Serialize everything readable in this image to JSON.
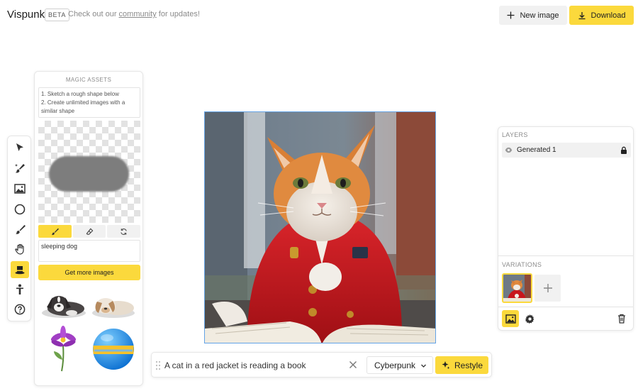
{
  "header": {
    "brand": "Vispunk",
    "beta": "BETA",
    "tagline_before": "Check out our ",
    "tagline_link": "community",
    "tagline_after": " for updates!",
    "new_image_label": "New image",
    "download_label": "Download"
  },
  "tools": [
    {
      "name": "select-tool",
      "icon": "pointer-icon"
    },
    {
      "name": "brush-sparkle-tool",
      "icon": "brush-sparkle-icon"
    },
    {
      "name": "image-tool",
      "icon": "image-icon"
    },
    {
      "name": "shape-tool",
      "icon": "circle-icon"
    },
    {
      "name": "brush-tool",
      "icon": "paintbrush-icon"
    },
    {
      "name": "hand-tool",
      "icon": "hand-icon"
    },
    {
      "name": "magic-assets-tool",
      "icon": "magic-hat-icon",
      "active": true
    },
    {
      "name": "pose-tool",
      "icon": "person-icon"
    },
    {
      "name": "help-tool",
      "icon": "help-icon"
    }
  ],
  "magic_assets": {
    "title": "MAGIC ASSETS",
    "instructions": [
      "1. Sketch a rough shape below",
      "2. Create unlimited images with a similar shape"
    ],
    "prompt": "sleeping dog",
    "more_button": "Get more images"
  },
  "prompt_bar": {
    "prompt": "A cat in a red jacket is reading a book",
    "style": "Cyberpunk",
    "restyle_label": "Restyle"
  },
  "layers_panel": {
    "layers_label": "LAYERS",
    "layers": [
      {
        "name": "Generated 1"
      }
    ],
    "variations_label": "VARIATIONS"
  },
  "colors": {
    "accent": "#fbd93c",
    "selection": "#63a3e6",
    "jacket": "#c8161c"
  }
}
